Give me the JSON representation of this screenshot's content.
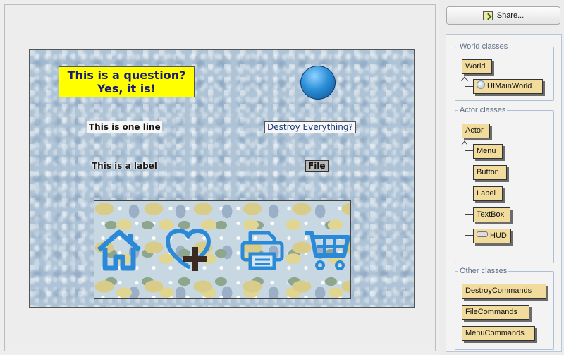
{
  "toolbar": {
    "share_label": "Share..."
  },
  "world": {
    "question_label": "This is a question?\nYes, it is!",
    "one_line_label": "This is one line",
    "destroy_button": "Destroy Everything?",
    "plain_label": "This is a label",
    "file_menu": "File",
    "hud_icons": [
      "home-icon",
      "heart-plus-icon",
      "printer-icon",
      "shopping-cart-icon"
    ],
    "colors": {
      "question_bg": "#ffff00",
      "hud_icon": "#2b8ad8",
      "world_bg": "#aec3d6"
    }
  },
  "class_panel": {
    "world_group": {
      "title": "World classes",
      "classes": [
        "World",
        "UIMainWorld"
      ]
    },
    "actor_group": {
      "title": "Actor classes",
      "classes": [
        "Actor",
        "Menu",
        "Button",
        "Label",
        "TextBox",
        "HUD"
      ]
    },
    "other_group": {
      "title": "Other classes",
      "classes": [
        "DestroyCommands",
        "FileCommands",
        "MenuCommands"
      ]
    }
  }
}
